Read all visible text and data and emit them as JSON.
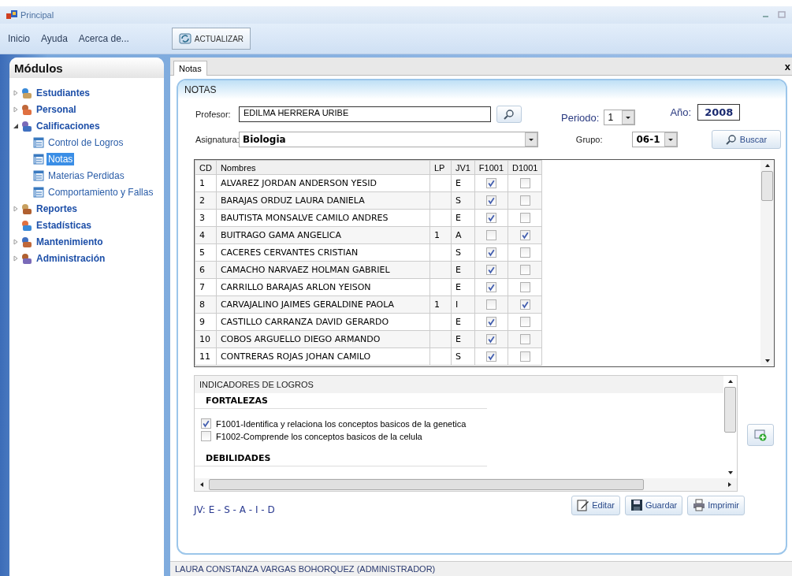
{
  "window": {
    "title": "Principal"
  },
  "menu": [
    "Inicio",
    "Ayuda",
    "Acerca de..."
  ],
  "toolbar": {
    "refresh_button": "ACTUALIZAR"
  },
  "sidebar": {
    "title": "Módulos",
    "items": [
      {
        "label": "Estudiantes",
        "expanded": false
      },
      {
        "label": "Personal",
        "expanded": false
      },
      {
        "label": "Calificaciones",
        "expanded": true,
        "children": [
          {
            "label": "Control de Logros",
            "selected": false
          },
          {
            "label": "Notas",
            "selected": true
          },
          {
            "label": "Materias Perdidas",
            "selected": false
          },
          {
            "label": "Comportamiento y Fallas",
            "selected": false
          }
        ]
      },
      {
        "label": "Reportes",
        "expanded": false
      },
      {
        "label": "Estadísticas"
      },
      {
        "label": "Mantenimiento",
        "expanded": false
      },
      {
        "label": "Administración",
        "expanded": false
      }
    ]
  },
  "tabs": [
    {
      "label": "Notas",
      "selected": true
    }
  ],
  "tab_close": "x",
  "panel": {
    "title": "NOTAS"
  },
  "form": {
    "profesor_label": "Profesor:",
    "profesor": "EDILMA  HERRERA URIBE",
    "asignatura_label": "Asignatura:",
    "asignatura": "Biologia",
    "periodo_label": "Periodo:",
    "periodo": "1",
    "ano_label": "Año:",
    "ano": "2008",
    "grupo_label": "Grupo:",
    "grupo": "06-1",
    "search_button": "Buscar"
  },
  "grid": {
    "columns": [
      "CD",
      "Nombres",
      "LP",
      "JV1",
      "F1001",
      "D1001"
    ],
    "rows": [
      {
        "cd": "1",
        "nombre": "ALVAREZ JORDAN ANDERSON YESID",
        "jv": "E",
        "f1001": true,
        "d1001": false
      },
      {
        "cd": "2",
        "nombre": "BARAJAS ORDUZ LAURA DANIELA",
        "jv": "S",
        "f1001": true,
        "d1001": false
      },
      {
        "cd": "3",
        "nombre": "BAUTISTA MONSALVE CAMILO ANDRES",
        "jv": "E",
        "f1001": true,
        "d1001": false
      },
      {
        "cd": "4",
        "nombre": "BUITRAGO GAMA ANGELICA",
        "lp": "1",
        "jv": "A",
        "f1001": false,
        "d1001": true
      },
      {
        "cd": "5",
        "nombre": "CACERES CERVANTES CRISTIAN",
        "jv": "S",
        "f1001": true,
        "d1001": false
      },
      {
        "cd": "6",
        "nombre": "CAMACHO NARVAEZ HOLMAN GABRIEL",
        "jv": "E",
        "f1001": true,
        "d1001": false
      },
      {
        "cd": "7",
        "nombre": "CARRILLO BARAJAS ARLON YEISON",
        "jv": "E",
        "f1001": true,
        "d1001": false
      },
      {
        "cd": "8",
        "nombre": "CARVAJALINO JAIMES GERALDINE PAOLA",
        "lp": "1",
        "jv": "I",
        "f1001": false,
        "d1001": true
      },
      {
        "cd": "9",
        "nombre": "CASTILLO CARRANZA DAVID GERARDO",
        "jv": "E",
        "f1001": true,
        "d1001": false
      },
      {
        "cd": "10",
        "nombre": "COBOS ARGUELLO DIEGO ARMANDO",
        "jv": "E",
        "f1001": true,
        "d1001": false
      },
      {
        "cd": "11",
        "nombre": "CONTRERAS ROJAS JOHAN CAMILO",
        "jv": "S",
        "f1001": true,
        "d1001": false
      }
    ]
  },
  "indicators": {
    "title": "INDICADORES DE LOGROS",
    "sections": [
      {
        "heading": "FORTALEZAS",
        "items": [
          {
            "label": "F1001-Identifica y relaciona los conceptos basicos de la genetica",
            "checked": true
          },
          {
            "label": "F1002-Comprende los conceptos basicos de la celula",
            "checked": false
          }
        ]
      },
      {
        "heading": "DEBILIDADES"
      }
    ]
  },
  "legend": "JV: E - S - A - I - D",
  "buttons": [
    "Editar",
    "Guardar",
    "Imprimir"
  ],
  "status_bar": "LAURA CONSTANZA VARGAS BOHORQUEZ (ADMINISTRADOR)"
}
